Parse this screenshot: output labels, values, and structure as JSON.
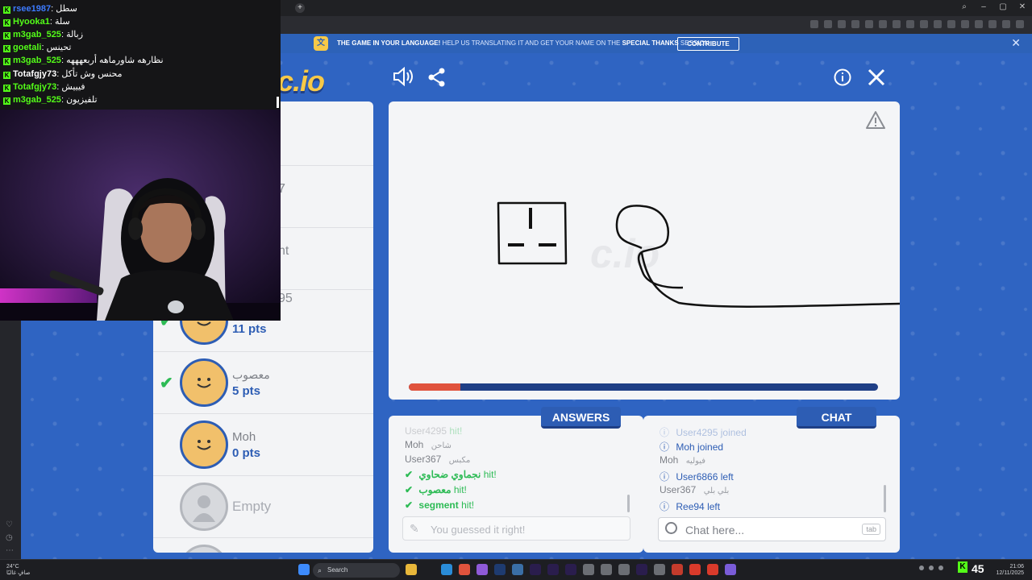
{
  "browser": {
    "new_tab_glyph": "+",
    "window_controls": [
      "⌕",
      "–",
      "▢",
      "✕"
    ]
  },
  "banner": {
    "title": "THE GAME IN YOUR LANGUAGE!",
    "text_before": "HELP US TRANSLATING IT AND GET YOUR NAME ON THE",
    "special": "SPECIAL THANKS",
    "text_after": "SESSION",
    "contribute_label": "CONTRIBUTE",
    "close_glyph": "✕"
  },
  "game": {
    "logo_text": "c.io",
    "toolbar_icons": [
      "speaker-icon",
      "share-icon",
      "info-icon",
      "close-icon"
    ],
    "players": [
      {
        "name": "",
        "pts": "",
        "partial": "7"
      },
      {
        "name": "",
        "pts": "",
        "partial": "nt"
      },
      {
        "name": "",
        "pts": "11 pts",
        "partial": "95",
        "guessed": true
      },
      {
        "name": "معصوب",
        "pts": "5 pts",
        "guessed": true
      },
      {
        "name": "Moh",
        "pts": "0 pts",
        "guessed": false
      }
    ],
    "empty_label": "Empty",
    "timer_progress": 0.11,
    "answers_label": "ANSWERS",
    "chat_label": "CHAT",
    "answers": [
      {
        "name": "User4295",
        "text": "hit!",
        "type": "hit-faded"
      },
      {
        "name": "Moh",
        "text": "شاحن",
        "type": "guess"
      },
      {
        "name": "User367",
        "text": "مكبس",
        "type": "guess"
      },
      {
        "name": "نجماوي ضحاوي",
        "text": "hit!",
        "type": "hit"
      },
      {
        "name": "معصوب",
        "text": "hit!",
        "type": "hit"
      },
      {
        "name": "segment",
        "text": "hit!",
        "type": "hit"
      }
    ],
    "guess_placeholder": "You guessed it right!",
    "chat": [
      {
        "name": "User4295",
        "text": "joined",
        "type": "info-faded"
      },
      {
        "name": "Moh",
        "text": "joined",
        "type": "info"
      },
      {
        "name": "Moh",
        "text": "فيوليه",
        "type": "msg"
      },
      {
        "name": "User6866",
        "text": "left",
        "type": "info"
      },
      {
        "name": "User367",
        "text": "بلي بلي",
        "type": "msg"
      },
      {
        "name": "Ree94",
        "text": "left",
        "type": "info"
      }
    ],
    "chat_placeholder": "Chat here...",
    "chat_tab_hint": "tab"
  },
  "stream_chat": [
    {
      "user": "rsee1987",
      "color": "#3d7bff",
      "text": "سطل"
    },
    {
      "user": "Hyooka1",
      "color": "#53fc18",
      "text": "سلة"
    },
    {
      "user": "m3gab_525",
      "color": "#53fc18",
      "text": "زبالة"
    },
    {
      "user": "goetali",
      "color": "#53fc18",
      "text": "تحينس"
    },
    {
      "user": "m3gab_525",
      "color": "#53fc18",
      "text": "نظارهه شاورماهه أربعهههه"
    },
    {
      "user": "Totafgjy73",
      "color": "#ffffff",
      "text": "محنس وش تأكل"
    },
    {
      "user": "Totafgjy73",
      "color": "#ffffff",
      "text": "فيييش"
    },
    {
      "user": "m3gab_525",
      "color": "#53fc18",
      "text": "تلفيزيون"
    }
  ],
  "taskbar": {
    "weather_temp": "24°C",
    "weather_desc": "صافٍ غالبًا",
    "search_label": "Search",
    "viewer_count": "45",
    "time": "21:06",
    "date": "12/11/2025"
  },
  "colors": {
    "game_bg": "#2f64c2",
    "accent_blue": "#2d5db4",
    "guess_green": "#2dbb55",
    "logo_yellow": "#f7c948",
    "timer_red": "#e0533d",
    "kick_green": "#53fc18"
  }
}
